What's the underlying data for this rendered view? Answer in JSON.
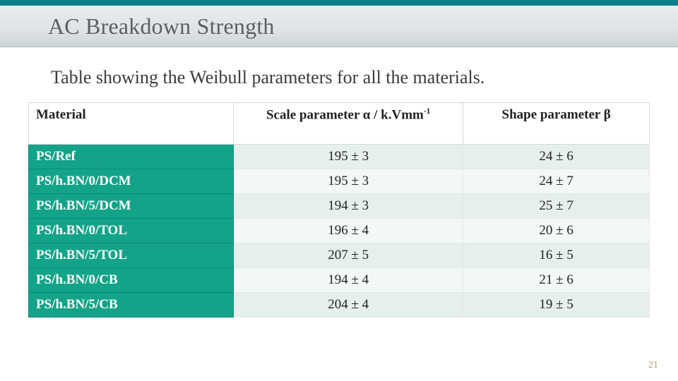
{
  "header": {
    "title": "AC Breakdown Strength"
  },
  "subtitle": "Table showing the Weibull parameters for all the materials.",
  "table": {
    "columns": {
      "material": "Material",
      "scale_prefix": "Scale parameter α / k.Vmm",
      "scale_sup": "-1",
      "shape": "Shape parameter β"
    },
    "rows": [
      {
        "material": "PS/Ref",
        "scale": "195 ± 3",
        "shape": "24 ± 6"
      },
      {
        "material": "PS/h.BN/0/DCM",
        "scale": "195 ± 3",
        "shape": "24 ± 7"
      },
      {
        "material": "PS/h.BN/5/DCM",
        "scale": "194 ± 3",
        "shape": "25 ± 7"
      },
      {
        "material": "PS/h.BN/0/TOL",
        "scale": "196 ± 4",
        "shape": "20 ± 6"
      },
      {
        "material": "PS/h.BN/5/TOL",
        "scale": "207 ± 5",
        "shape": "16 ± 5"
      },
      {
        "material": "PS/h.BN/0/CB",
        "scale": "194 ± 4",
        "shape": "21 ± 6"
      },
      {
        "material": "PS/h.BN/5/CB",
        "scale": "204 ± 4",
        "shape": "19 ± 5"
      }
    ]
  },
  "page_number": "21",
  "chart_data": {
    "type": "table",
    "title": "Weibull parameters for all the materials",
    "columns": [
      "Material",
      "Scale parameter α / k.Vmm-1",
      "Shape parameter β"
    ],
    "rows": [
      [
        "PS/Ref",
        "195 ± 3",
        "24 ± 6"
      ],
      [
        "PS/h.BN/0/DCM",
        "195 ± 3",
        "24 ± 7"
      ],
      [
        "PS/h.BN/5/DCM",
        "194 ± 3",
        "25 ± 7"
      ],
      [
        "PS/h.BN/0/TOL",
        "196 ± 4",
        "20 ± 6"
      ],
      [
        "PS/h.BN/5/TOL",
        "207 ± 5",
        "16 ± 5"
      ],
      [
        "PS/h.BN/0/CB",
        "194 ± 4",
        "21 ± 6"
      ],
      [
        "PS/h.BN/5/CB",
        "204 ± 4",
        "19 ± 5"
      ]
    ]
  }
}
